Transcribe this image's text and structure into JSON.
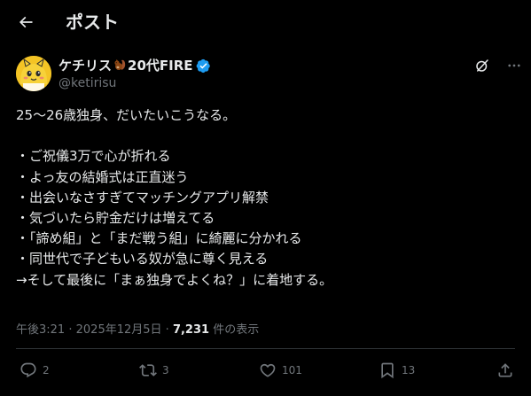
{
  "header": {
    "title": "ポスト"
  },
  "author": {
    "display_name_prefix": "ケチリス",
    "display_name_suffix": "20代FIRE",
    "handle": "@ketirisu"
  },
  "tweet": {
    "lines": [
      "25〜26歳独身、だいたいこうなる。",
      "",
      "・ご祝儀3万で心が折れる",
      "・よっ友の結婚式は正直迷う",
      "・出会いなさすぎてマッチングアプリ解禁",
      "・気づいたら貯金だけは増えてる",
      "・「諦め組」と「まだ戦う組」に綺麗に分かれる",
      "・同世代で子どもいる奴が急に尊く見える",
      "→そして最後に「まぁ独身でよくね？」に着地する。"
    ]
  },
  "meta": {
    "time": "午後3:21",
    "separator": "·",
    "date": "2025年12月5日",
    "views_count": "7,231",
    "views_label": "件の表示"
  },
  "actions": {
    "replies": "2",
    "reposts": "3",
    "likes": "101",
    "bookmarks": "13"
  },
  "colors": {
    "background": "#000000",
    "text": "#e7e9ea",
    "secondary": "#71767b",
    "border": "#2f3336",
    "verified": "#1d9bf0"
  },
  "icons": {
    "back": "arrow-left-icon",
    "verified": "verified-badge-icon",
    "grok": "grok-icon",
    "more": "more-icon",
    "reply": "reply-icon",
    "repost": "repost-icon",
    "like": "like-icon",
    "bookmark": "bookmark-icon",
    "share": "share-icon"
  }
}
